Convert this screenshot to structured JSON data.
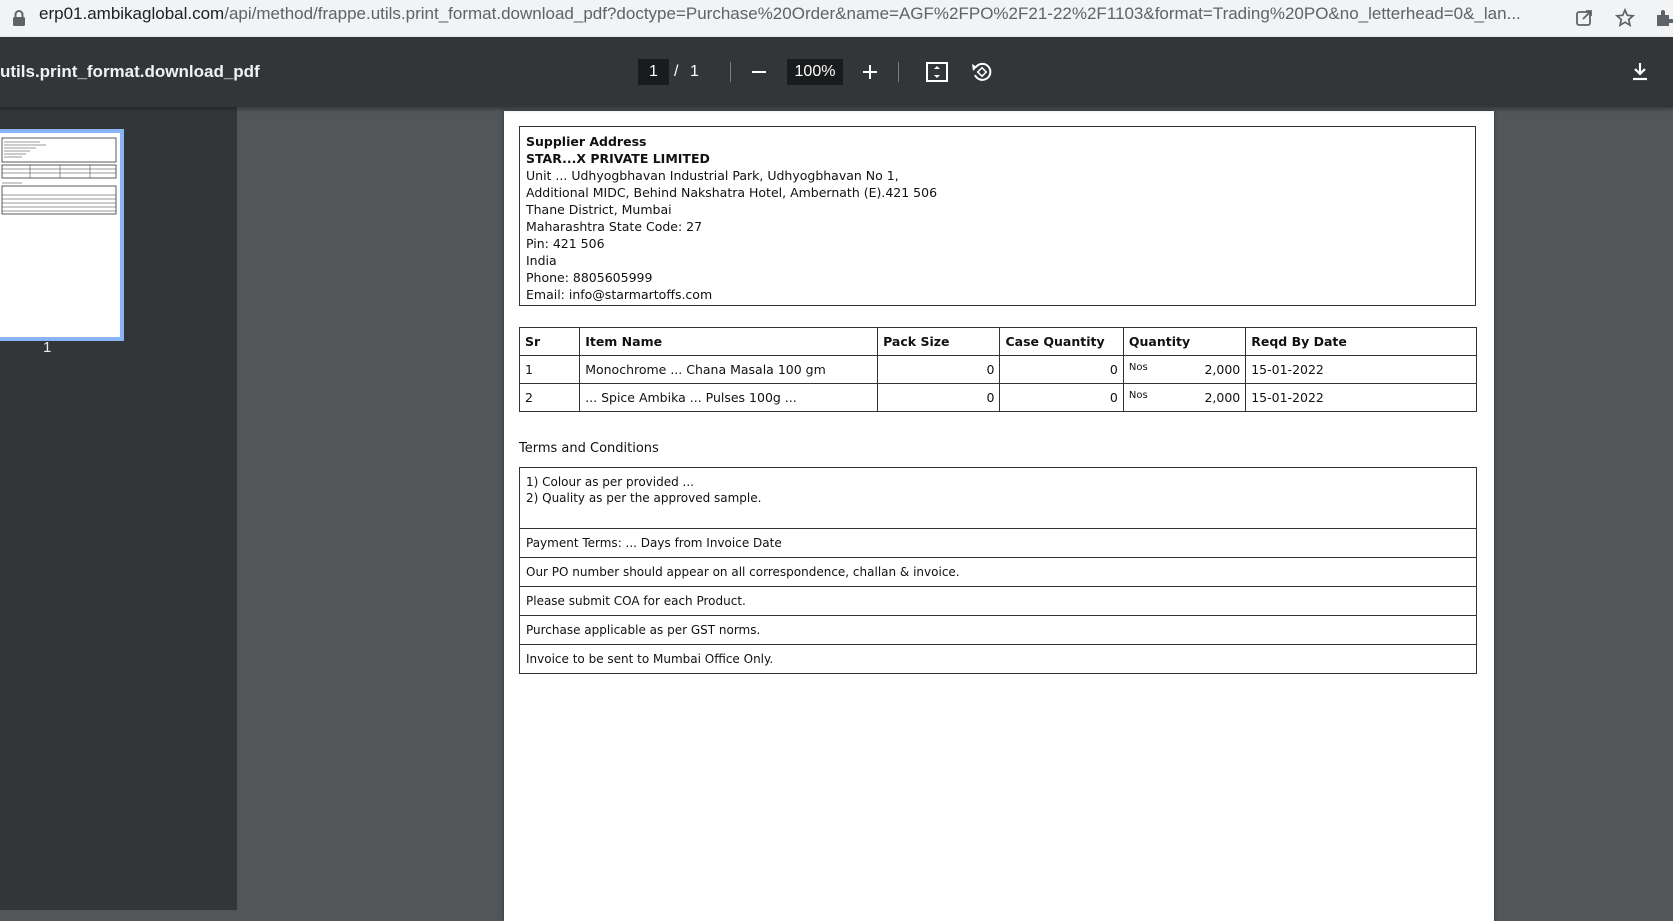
{
  "browser": {
    "url_host": "erp01.ambikaglobal.com",
    "url_path": "/api/method/frappe.utils.print_format.download_pdf?doctype=Purchase%20Order&name=AGF%2FPO%2F21-22%2F1103&format=Trading%20PO&no_letterhead=0&_lan..."
  },
  "toolbar": {
    "title": "utils.print_format.download_pdf",
    "current_page": "1",
    "separator": "/",
    "total_pages": "1",
    "zoom": "100%"
  },
  "sidebar": {
    "thumb_label": "1"
  },
  "document": {
    "supplier": {
      "heading": "Supplier Address",
      "name": "STAR...X PRIVATE LIMITED",
      "lines": [
        "Unit ... Udhyogbhavan Industrial Park, Udhyogbhavan No 1,",
        "Additional MIDC, Behind Nakshatra Hotel, Ambernath (E).421 506",
        "Thane District, Mumbai",
        "Maharashtra State Code: 27",
        "Pin: 421 506",
        "India",
        "Phone: 8805605999",
        "Email: info@starmartoffs.com"
      ]
    },
    "table": {
      "headers": [
        "Sr",
        "Item Name",
        "Pack Size",
        "Case Quantity",
        "Quantity",
        "Reqd By Date"
      ],
      "rows": [
        {
          "sr": "1",
          "item": "Monochrome ... Chana Masala 100 gm",
          "pack": "0",
          "case_qty": "0",
          "uom": "Nos",
          "qty": "2,000",
          "date": "15-01-2022"
        },
        {
          "sr": "2",
          "item": "... Spice Ambika ... Pulses 100g ...",
          "pack": "0",
          "case_qty": "0",
          "uom": "Nos",
          "qty": "2,000",
          "date": "15-01-2022"
        }
      ]
    },
    "terms": {
      "heading": "Terms and Conditions",
      "main_lines": [
        "1) Colour as per provided ...",
        "2) Quality as per the approved sample."
      ],
      "rows": [
        "Payment Terms: ... Days from Invoice Date",
        "Our PO number should appear on all correspondence, challan & invoice.",
        "Please submit COA for each Product.",
        "Purchase applicable as per GST norms.",
        "Invoice to be sent to Mumbai Office Only."
      ]
    }
  }
}
